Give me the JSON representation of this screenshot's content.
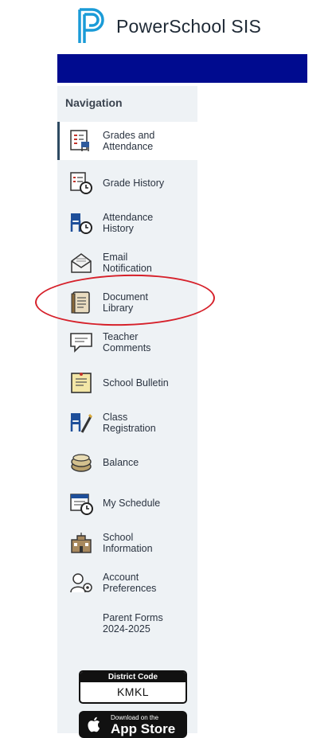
{
  "brand": {
    "name": "PowerSchool SIS",
    "color": "#1a9bd7"
  },
  "header_bar_color": "#000b8f",
  "nav": {
    "title": "Navigation",
    "items": [
      {
        "label": "Grades and\nAttendance",
        "icon": "grades-attendance-icon",
        "active": true
      },
      {
        "label": "Grade History",
        "icon": "grade-history-icon"
      },
      {
        "label": "Attendance\nHistory",
        "icon": "attendance-history-icon"
      },
      {
        "label": "Email\nNotification",
        "icon": "email-notification-icon"
      },
      {
        "label": "Document\nLibrary",
        "icon": "document-library-icon",
        "highlighted": true
      },
      {
        "label": "Teacher\nComments",
        "icon": "teacher-comments-icon"
      },
      {
        "label": "School Bulletin",
        "icon": "school-bulletin-icon"
      },
      {
        "label": "Class\nRegistration",
        "icon": "class-registration-icon"
      },
      {
        "label": "Balance",
        "icon": "balance-icon"
      },
      {
        "label": "My Schedule",
        "icon": "my-schedule-icon"
      },
      {
        "label": "School\nInformation",
        "icon": "school-information-icon"
      },
      {
        "label": "Account\nPreferences",
        "icon": "account-preferences-icon"
      },
      {
        "label": "Parent Forms\n2024-2025",
        "icon": ""
      }
    ]
  },
  "district": {
    "heading": "District Code",
    "code": "KMKL"
  },
  "appstore": {
    "small": "Download on the",
    "big": "App Store"
  },
  "highlight_color": "#d6202a"
}
